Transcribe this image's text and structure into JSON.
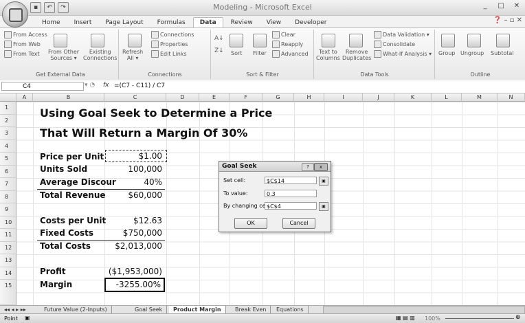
{
  "window": {
    "title": "Modeling - Microsoft Excel"
  },
  "ribbon": {
    "tabs": [
      "Home",
      "Insert",
      "Page Layout",
      "Formulas",
      "Data",
      "Review",
      "View",
      "Developer"
    ],
    "active_tab": "Data",
    "groups": {
      "get_external_data": {
        "label": "Get External Data",
        "from_access": "From Access",
        "from_web": "From Web",
        "from_text": "From Text",
        "from_other": "From Other",
        "sources": "Sources",
        "existing": "Existing",
        "connections": "Connections"
      },
      "connections": {
        "label": "Connections",
        "refresh": "Refresh",
        "all": "All",
        "connections": "Connections",
        "properties": "Properties",
        "edit_links": "Edit Links"
      },
      "sort_filter": {
        "label": "Sort & Filter",
        "sort": "Sort",
        "filter": "Filter",
        "clear": "Clear",
        "reapply": "Reapply",
        "advanced": "Advanced"
      },
      "data_tools": {
        "label": "Data Tools",
        "text_to": "Text to",
        "columns": "Columns",
        "remove": "Remove",
        "duplicates": "Duplicates",
        "data_validation": "Data Validation",
        "consolidate": "Consolidate",
        "what_if": "What-If Analysis"
      },
      "outline": {
        "label": "Outline",
        "group": "Group",
        "ungroup": "Ungroup",
        "subtotal": "Subtotal"
      }
    }
  },
  "formula_bar": {
    "name_box": "C4",
    "fx": "fx",
    "formula": "=(C7 - C11) / C7"
  },
  "columns": [
    "A",
    "B",
    "C",
    "D",
    "E",
    "F",
    "G",
    "H",
    "I",
    "J",
    "K",
    "L",
    "M",
    "N"
  ],
  "rows": [
    "1",
    "2",
    "3",
    "4",
    "5",
    "6",
    "7",
    "8",
    "9",
    "10",
    "11",
    "12",
    "13",
    "14",
    "15"
  ],
  "cells": {
    "title_line1": "Using Goal Seek to Determine a Price",
    "title_line2": "That Will Return a Margin Of 30%",
    "price_label": "Price per Unit",
    "price_value": "$1.00",
    "units_label": "Units Sold",
    "units_value": "100,000",
    "discount_label": "Average Discour",
    "discount_value": "40%",
    "revenue_label": "Total Revenue",
    "revenue_value": "$60,000",
    "cost_label": "Costs per Unit",
    "cost_value": "$12.63",
    "fixed_label": "Fixed Costs",
    "fixed_value": "$750,000",
    "total_cost_label": "Total Costs",
    "total_cost_value": "$2,013,000",
    "profit_label": "Profit",
    "profit_value": "($1,953,000)",
    "margin_label": "Margin",
    "margin_value": "-3255.00%"
  },
  "goal_seek": {
    "title": "Goal Seek",
    "help": "?",
    "close": "x",
    "set_cell_label": "Set cell:",
    "set_cell_value": "$C$14",
    "to_value_label": "To value:",
    "to_value_value": "0.3",
    "changing_cell_label": "By changing cell:",
    "changing_cell_value": "$C$4",
    "ok": "OK",
    "cancel": "Cancel"
  },
  "sheet_tabs": [
    "Future Value (2-Inputs)",
    "Goal Seek",
    "Product Margin",
    "Break Even",
    "Equations"
  ],
  "active_sheet": "Product Margin",
  "status": {
    "mode": "Point",
    "zoom": "100%"
  }
}
